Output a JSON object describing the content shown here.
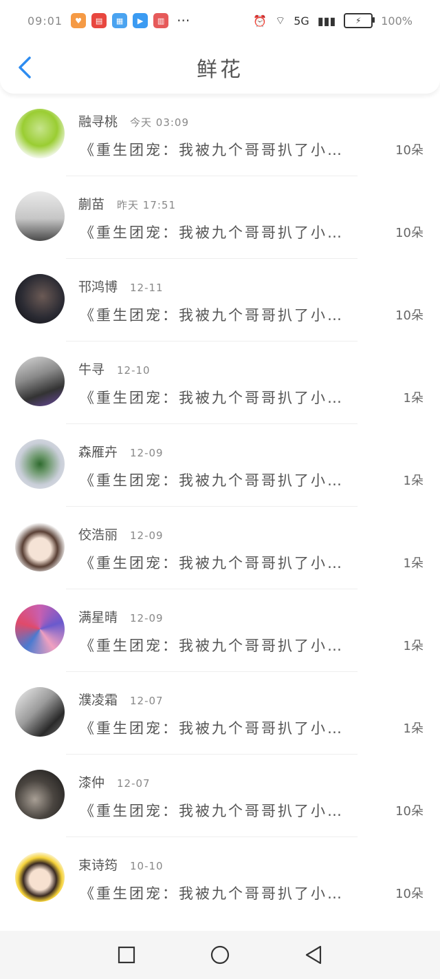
{
  "status_bar": {
    "time": "09:01",
    "signal_label": "5G",
    "battery_percent": "100%"
  },
  "header": {
    "title": "鲜花",
    "back_icon": "chevron-left-icon"
  },
  "items": [
    {
      "name": "融寻桃",
      "time": "今天 03:09",
      "message": "《重生团宠：我被九个哥哥扒了小…",
      "count": "10朵"
    },
    {
      "name": "蒯苗",
      "time": "昨天 17:51",
      "message": "《重生团宠：我被九个哥哥扒了小…",
      "count": "10朵"
    },
    {
      "name": "邗鸿博",
      "time": "12-11",
      "message": "《重生团宠：我被九个哥哥扒了小…",
      "count": "10朵"
    },
    {
      "name": "牛寻",
      "time": "12-10",
      "message": "《重生团宠：我被九个哥哥扒了小…",
      "count": "1朵"
    },
    {
      "name": "森雁卉",
      "time": "12-09",
      "message": "《重生团宠：我被九个哥哥扒了小…",
      "count": "1朵"
    },
    {
      "name": "佼浩丽",
      "time": "12-09",
      "message": "《重生团宠：我被九个哥哥扒了小…",
      "count": "1朵"
    },
    {
      "name": "满星晴",
      "time": "12-09",
      "message": "《重生团宠：我被九个哥哥扒了小…",
      "count": "1朵"
    },
    {
      "name": "濮凌霜",
      "time": "12-07",
      "message": "《重生团宠：我被九个哥哥扒了小…",
      "count": "1朵"
    },
    {
      "name": "漆仲",
      "time": "12-07",
      "message": "《重生团宠：我被九个哥哥扒了小…",
      "count": "10朵"
    },
    {
      "name": "束诗筠",
      "time": "10-10",
      "message": "《重生团宠：我被九个哥哥扒了小…",
      "count": "10朵"
    }
  ],
  "colors": {
    "accent": "#2e8cf0",
    "text": "#555555",
    "muted": "#888888",
    "divider": "#eeeeee",
    "nav_bar": "#f5f5f5"
  }
}
